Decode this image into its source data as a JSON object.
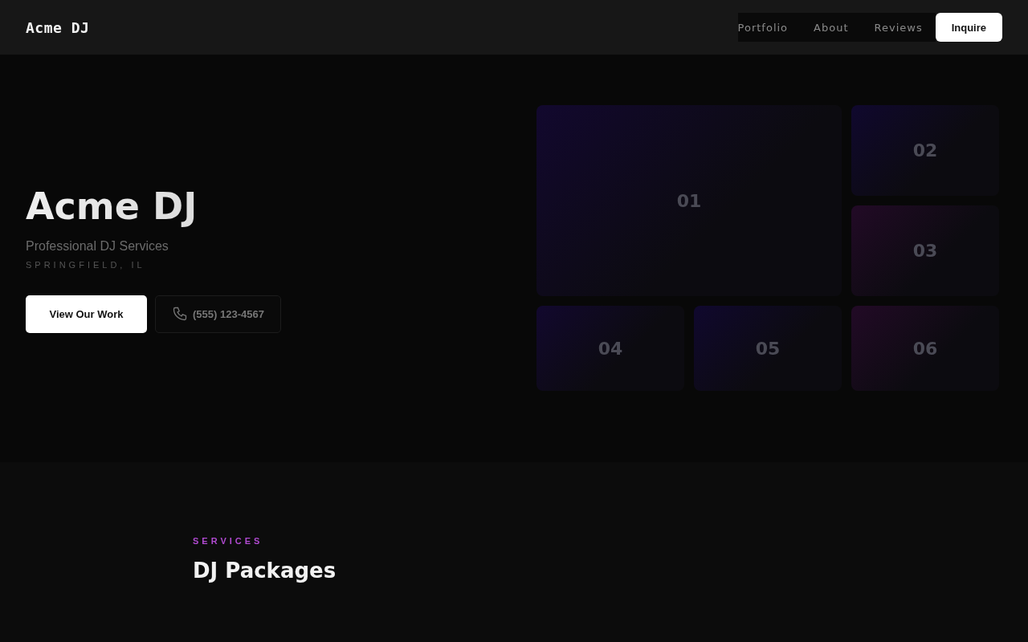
{
  "header": {
    "logo": "Acme DJ",
    "nav": [
      "Portfolio",
      "About",
      "Reviews"
    ],
    "cta": "Inquire"
  },
  "hero": {
    "title": "Acme DJ",
    "subtitle": "Professional DJ Services",
    "location": "SPRINGFIELD, IL",
    "primary_button": "View Our Work",
    "phone_button": "(555) 123-4567"
  },
  "tiles": [
    {
      "label": "01",
      "color": "#12082e"
    },
    {
      "label": "02",
      "color": "#10082e"
    },
    {
      "label": "03",
      "color": "#220a26"
    },
    {
      "label": "04",
      "color": "#12082e"
    },
    {
      "label": "05",
      "color": "#10082e"
    },
    {
      "label": "06",
      "color": "#220a26"
    }
  ],
  "services": {
    "eyebrow": "SERVICES",
    "heading": "DJ Packages"
  }
}
